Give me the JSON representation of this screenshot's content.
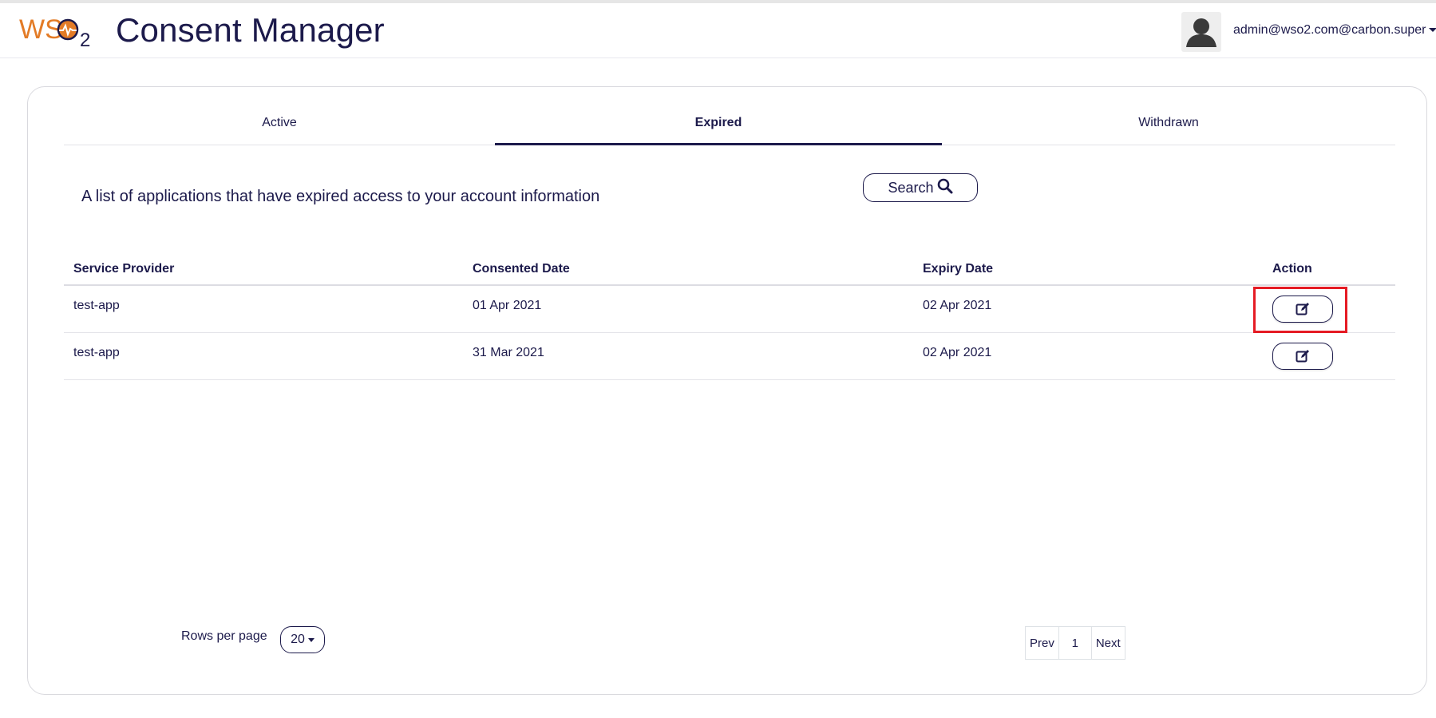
{
  "header": {
    "app_title": "Consent Manager",
    "user": "admin@wso2.com@carbon.super",
    "logo_alt": "WSO2"
  },
  "tabs": [
    {
      "label": "Active"
    },
    {
      "label": "Expired",
      "active": true
    },
    {
      "label": "Withdrawn"
    }
  ],
  "list": {
    "description": "A list of applications that have expired access to your account information",
    "search_label": "Search"
  },
  "table": {
    "columns": [
      "Service Provider",
      "Consented Date",
      "Expiry Date",
      "Action"
    ],
    "rows": [
      {
        "service_provider": "test-app",
        "consented_date": "01 Apr 2021",
        "expiry_date": "02 Apr 2021"
      },
      {
        "service_provider": "test-app",
        "consented_date": "31 Mar 2021",
        "expiry_date": "02 Apr 2021"
      }
    ]
  },
  "pagination": {
    "rows_per_page_label": "Rows per page",
    "rows_per_page_value": "20",
    "prev_label": "Prev",
    "current_page": "1",
    "next_label": "Next"
  },
  "colors": {
    "primary": "#1c1a4b",
    "brand_orange": "#e37b26",
    "highlight": "#e51b24"
  }
}
